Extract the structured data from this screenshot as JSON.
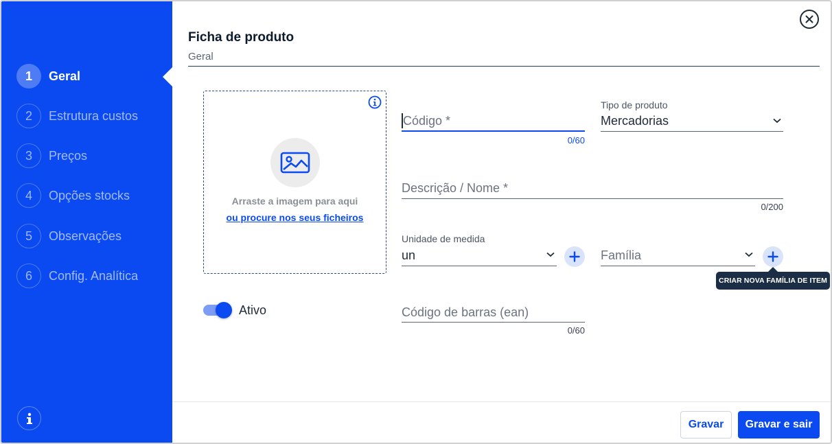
{
  "sidebar": {
    "steps": [
      {
        "num": "1",
        "label": "Geral",
        "active": true
      },
      {
        "num": "2",
        "label": "Estrutura custos"
      },
      {
        "num": "3",
        "label": "Preços"
      },
      {
        "num": "4",
        "label": "Opções stocks"
      },
      {
        "num": "5",
        "label": "Observações"
      },
      {
        "num": "6",
        "label": "Config. Analítica"
      }
    ],
    "info_icon": "info-icon"
  },
  "header": {
    "title": "Ficha de produto",
    "subtitle": "Geral",
    "close_icon": "close-circle-icon"
  },
  "image_upload": {
    "drag_text": "Arraste a imagem para aqui",
    "browse_link": "ou procure nos seus ficheiros",
    "icon": "image-icon",
    "info_icon": "info-icon"
  },
  "form": {
    "codigo": {
      "placeholder": "Código *",
      "counter": "0/60"
    },
    "tipo_produto": {
      "label": "Tipo de produto",
      "value": "Mercadorias"
    },
    "descricao": {
      "placeholder": "Descrição / Nome *",
      "counter": "0/200"
    },
    "unidade": {
      "label": "Unidade de medida",
      "value": "un"
    },
    "familia": {
      "placeholder": "Família"
    },
    "codigo_barras": {
      "placeholder": "Código de barras (ean)",
      "counter": "0/60"
    },
    "ativo": {
      "label": "Ativo",
      "checked": true
    }
  },
  "tooltip": {
    "text": "CRIAR NOVA FAMÍLIA DE ITEM"
  },
  "footer": {
    "save_label": "Gravar",
    "save_exit_label": "Gravar e sair"
  },
  "colors": {
    "primary": "#0a4af0",
    "sidebar_bg": "#0a4af0",
    "tooltip_bg": "#1b2e45"
  }
}
